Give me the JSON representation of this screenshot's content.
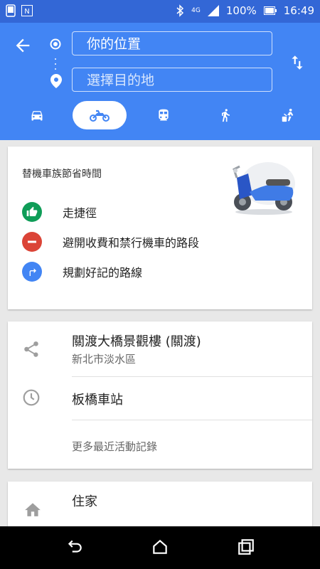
{
  "status_bar": {
    "left_label": "N",
    "battery_percent": "100%",
    "time": "16:49",
    "network": "4G"
  },
  "directions": {
    "from_value": "你的位置",
    "to_placeholder": "選擇目的地",
    "modes": [
      {
        "name": "car",
        "icon": "car-icon",
        "active": false
      },
      {
        "name": "motorcycle",
        "icon": "motorcycle-icon",
        "active": true
      },
      {
        "name": "transit",
        "icon": "train-icon",
        "active": false
      },
      {
        "name": "walk",
        "icon": "walk-icon",
        "active": false
      },
      {
        "name": "ride-share",
        "icon": "ride-share-icon",
        "active": false
      }
    ]
  },
  "promo": {
    "title": "替機車族節省時間",
    "items": [
      {
        "label": "走捷徑",
        "icon": "thumbs-up-icon",
        "color": "#0f9d58"
      },
      {
        "label": "避開收費和禁行機車的路段",
        "icon": "no-entry-icon",
        "color": "#db4437"
      },
      {
        "label": "規劃好記的路線",
        "icon": "turn-right-icon",
        "color": "#4285f4"
      }
    ]
  },
  "recent": {
    "items": [
      {
        "title": "關渡大橋景觀樓 (關渡)",
        "subtitle": "新北市淡水區",
        "icon": "share-icon"
      },
      {
        "title": "板橋車站",
        "subtitle": "",
        "icon": "history-icon"
      }
    ],
    "more_label": "更多最近活動記錄"
  },
  "home": {
    "title": "住家",
    "icon": "home-icon"
  },
  "colors": {
    "header": "#4285f4",
    "status_bar": "#3367d6"
  }
}
